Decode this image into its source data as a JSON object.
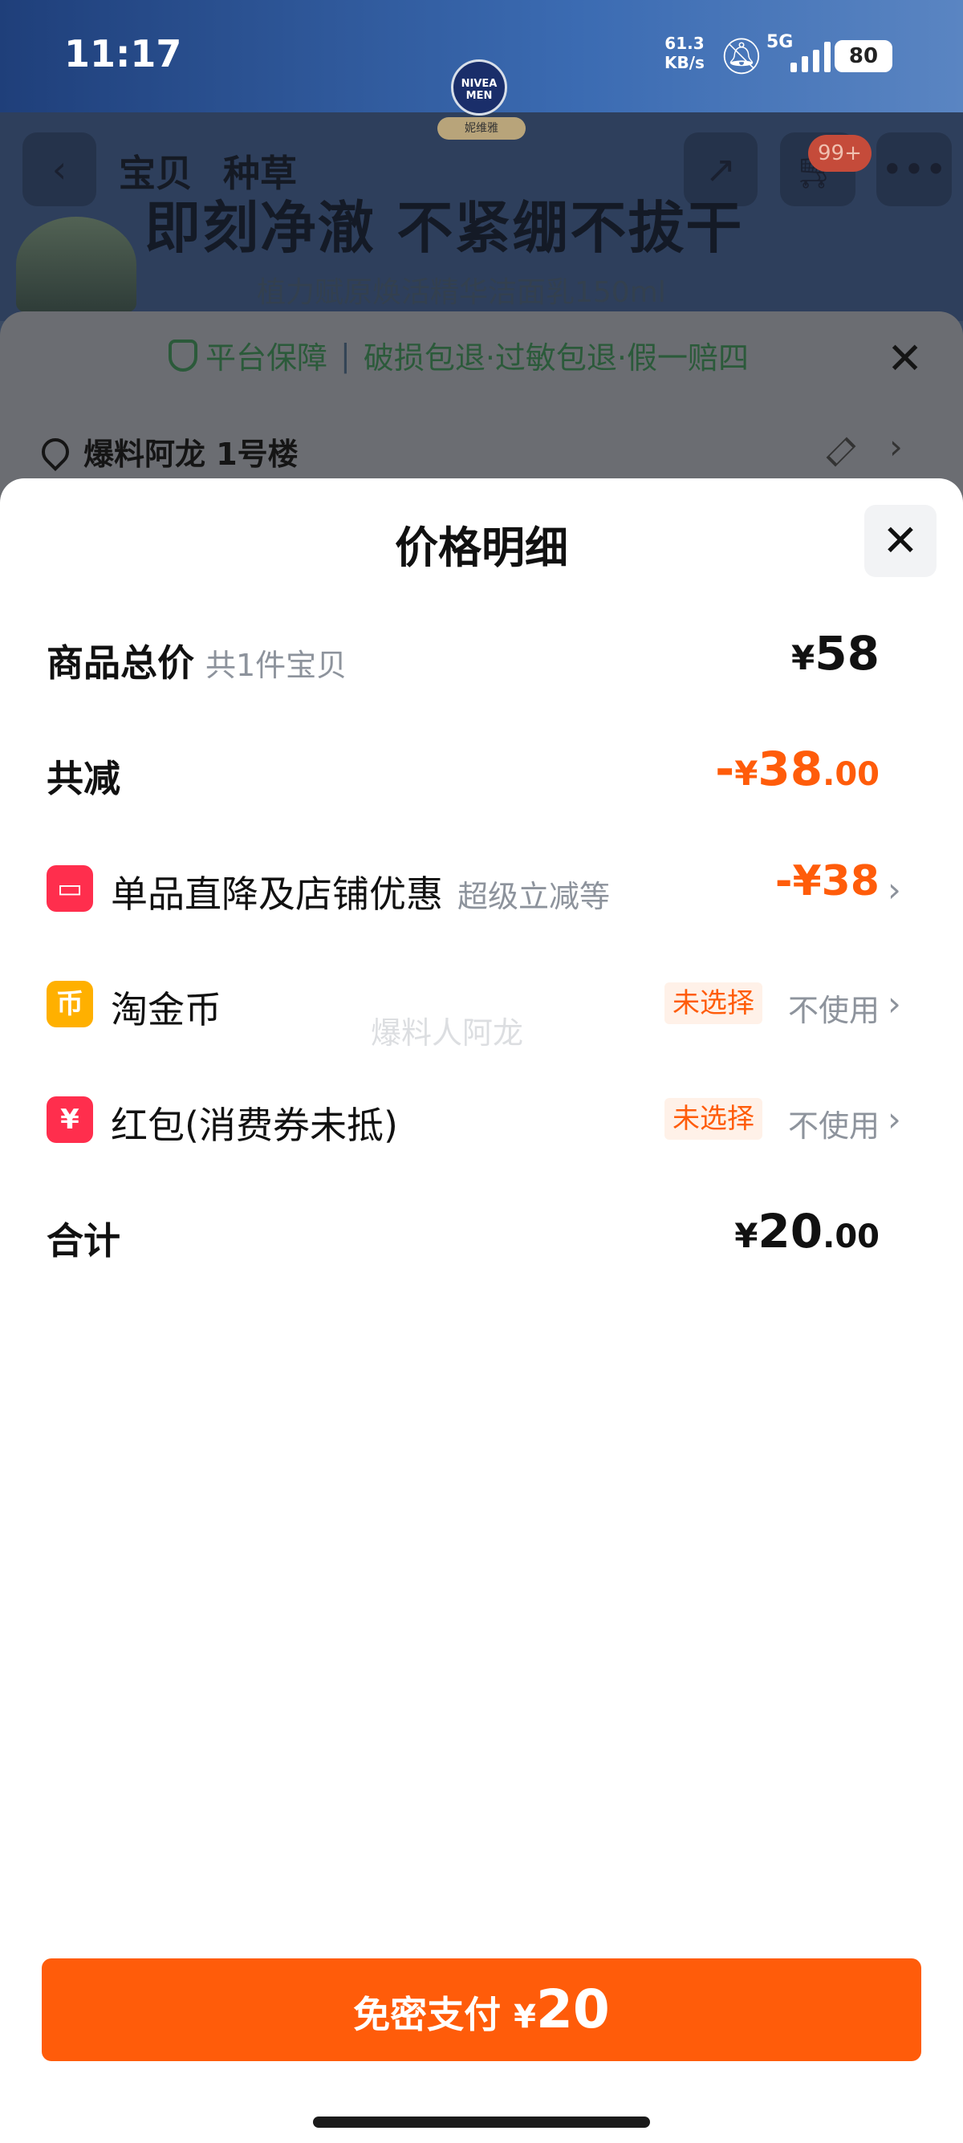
{
  "status_bar": {
    "time": "11:17",
    "network_speed": "61.3",
    "network_unit": "KB/s",
    "network_type": "5G",
    "battery": "80"
  },
  "background_page": {
    "brand_logo_text": "NIVEA MEN",
    "brand_logo_sub": "妮维雅",
    "tabs": [
      "宝贝",
      "种草"
    ],
    "cart_badge": "99+",
    "hero_title": "即刻净澈 不紧绷不拔干",
    "hero_subtitle": "植力赋原焕活精华洁面乳150ml",
    "guarantee": {
      "label": "平台保障",
      "items": "破损包退·过敏包退·假一赔四"
    },
    "address": "爆料阿龙 1号楼"
  },
  "sheet": {
    "title": "价格明细",
    "total": {
      "label": "商品总价",
      "hint": "共1件宝贝",
      "currency": "¥",
      "value": "58"
    },
    "reduction": {
      "label": "共减",
      "sign": "-",
      "currency": "¥",
      "integer": "38",
      "decimal": ".00"
    },
    "items": [
      {
        "label": "单品直降及店铺优惠",
        "hint": "超级立减等",
        "value": "-¥38",
        "icon": "store-discount-icon",
        "icon_color": "#ff2e4d"
      },
      {
        "label": "淘金币",
        "badge": "未选择",
        "status": "不使用",
        "icon": "coin-icon",
        "icon_color": "#ffb000"
      },
      {
        "label": "红包(消费券未抵)",
        "badge": "未选择",
        "status": "不使用",
        "icon": "red-packet-icon",
        "icon_color": "#ff2e4d"
      }
    ],
    "sum": {
      "label": "合计",
      "currency": "¥",
      "integer": "20",
      "decimal": ".00"
    },
    "watermark": "爆料人阿龙"
  },
  "pay_button": {
    "label": "免密支付",
    "currency": "¥",
    "amount": "20"
  },
  "colors": {
    "accent": "#ff5c0a",
    "badge_bg": "#fff1e8",
    "text_primary": "#111111",
    "text_secondary": "#8d939c"
  }
}
